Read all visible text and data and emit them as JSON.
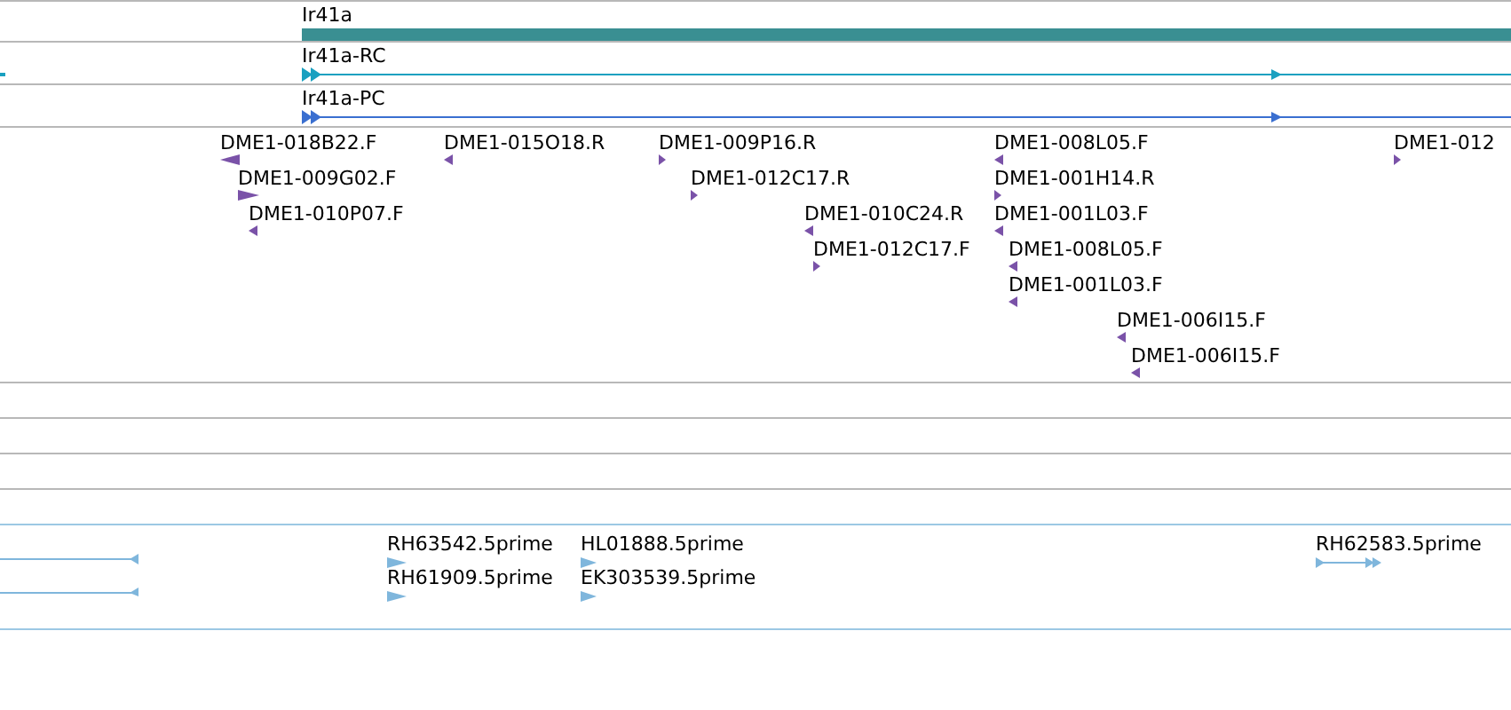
{
  "gene": {
    "label": "Ir41a"
  },
  "transcripts": [
    {
      "label": "Ir41a-RC",
      "kind": "rna"
    },
    {
      "label": "Ir41a-PC",
      "kind": "protein"
    }
  ],
  "probes": [
    {
      "label": "DME1-018B22.F",
      "reverse": true
    },
    {
      "label": "DME1-009G02.F",
      "reverse": false
    },
    {
      "label": "DME1-010P07.F",
      "reverse": true
    },
    {
      "label": "DME1-015O18.R",
      "reverse": true
    },
    {
      "label": "DME1-009P16.R",
      "reverse": false
    },
    {
      "label": "DME1-012C17.R",
      "reverse": false
    },
    {
      "label": "DME1-010C24.R",
      "reverse": true
    },
    {
      "label": "DME1-012C17.F",
      "reverse": false
    },
    {
      "label": "DME1-008L05.F",
      "reverse": true
    },
    {
      "label": "DME1-001H14.R",
      "reverse": false
    },
    {
      "label": "DME1-001L03.F",
      "reverse": true
    },
    {
      "label": "DME1-008L05.F",
      "reverse": true
    },
    {
      "label": "DME1-001L03.F",
      "reverse": true
    },
    {
      "label": "DME1-006I15.F",
      "reverse": true
    },
    {
      "label": "DME1-006I15.F",
      "reverse": true
    },
    {
      "label": "DME1-012",
      "reverse": false
    }
  ],
  "cdnas": [
    {
      "label": "RH63542.5prime",
      "reverse": false
    },
    {
      "label": "RH61909.5prime",
      "reverse": false
    },
    {
      "label": "HL01888.5prime",
      "reverse": false
    },
    {
      "label": "EK303539.5prime",
      "reverse": false
    },
    {
      "label": "RH62583.5prime",
      "reverse": false
    }
  ]
}
